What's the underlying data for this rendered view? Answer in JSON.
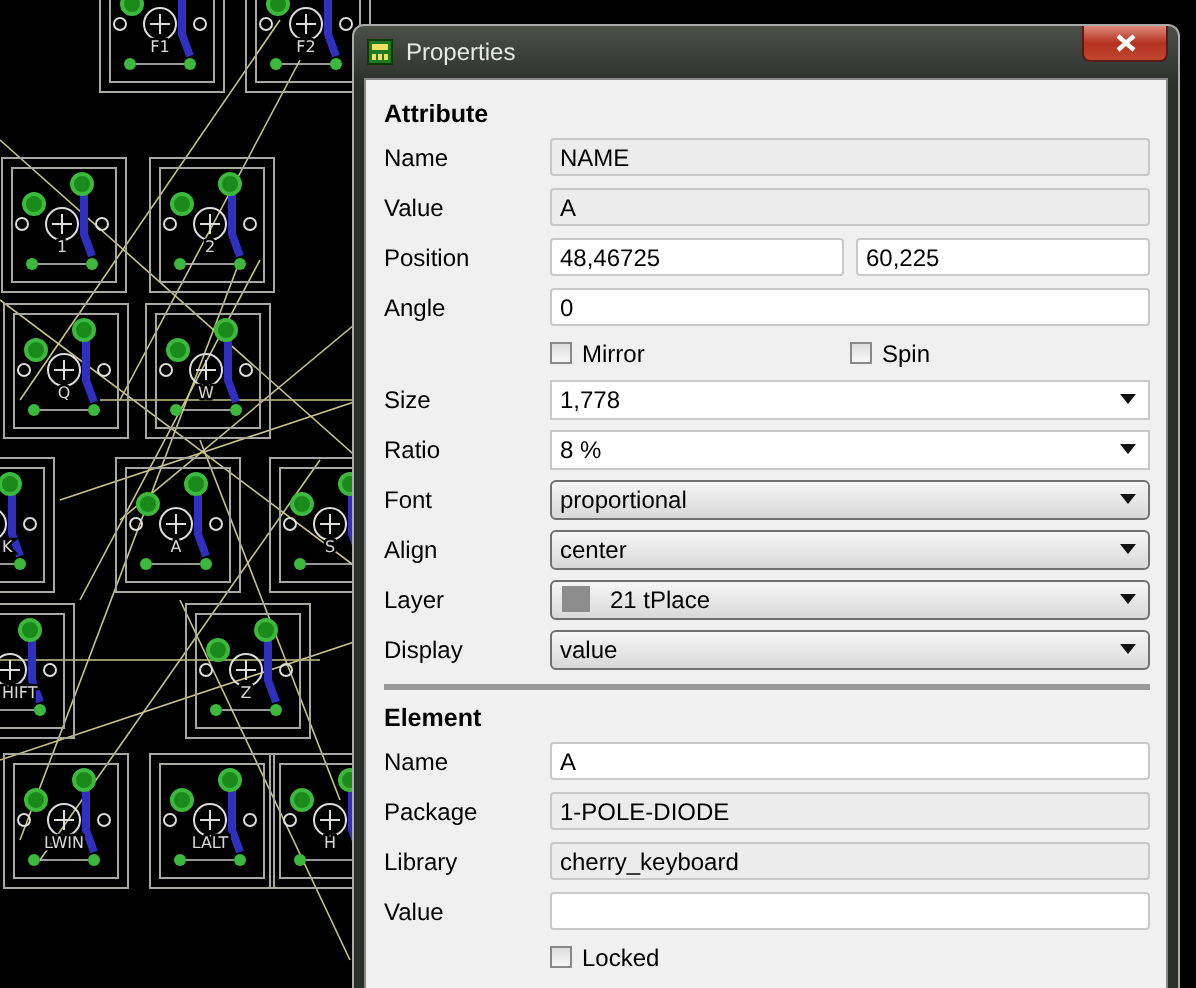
{
  "window": {
    "title": "Properties"
  },
  "board": {
    "labels": [
      "F1",
      "F2",
      "1",
      "2",
      "Q",
      "W",
      "K",
      "A",
      "S",
      "HIFT",
      "Z",
      "LWIN",
      "LALT",
      "H"
    ]
  },
  "sections": [
    {
      "title": "Attribute",
      "rows": [
        {
          "kind": "text",
          "label": "Name",
          "value": "NAME",
          "disabled": true
        },
        {
          "kind": "text",
          "label": "Value",
          "value": "A",
          "disabled": true
        },
        {
          "kind": "pair",
          "label": "Position",
          "values": [
            "48,46725",
            "60,225"
          ]
        },
        {
          "kind": "text",
          "label": "Angle",
          "value": "0",
          "disabled": false
        },
        {
          "kind": "checks",
          "items": [
            {
              "label": "Mirror",
              "checked": false
            },
            {
              "label": "Spin",
              "checked": false
            }
          ]
        },
        {
          "kind": "combo",
          "label": "Size",
          "value": "1,778",
          "editable": true
        },
        {
          "kind": "combo",
          "label": "Ratio",
          "value": "8 %",
          "editable": true
        },
        {
          "kind": "combo",
          "label": "Font",
          "value": "proportional",
          "editable": false
        },
        {
          "kind": "combo",
          "label": "Align",
          "value": "center",
          "editable": false
        },
        {
          "kind": "combo",
          "label": "Layer",
          "value": "21 tPlace",
          "editable": false,
          "color": "#8c8c8c"
        },
        {
          "kind": "combo",
          "label": "Display",
          "value": "value",
          "editable": false
        }
      ]
    },
    {
      "title": "Element",
      "rows": [
        {
          "kind": "text",
          "label": "Name",
          "value": "A",
          "disabled": false
        },
        {
          "kind": "text",
          "label": "Package",
          "value": "1-POLE-DIODE",
          "disabled": true
        },
        {
          "kind": "text",
          "label": "Library",
          "value": "cherry_keyboard",
          "disabled": true
        },
        {
          "kind": "text",
          "label": "Value",
          "value": "",
          "disabled": false
        },
        {
          "kind": "checks",
          "items": [
            {
              "label": "Locked",
              "checked": false
            }
          ]
        }
      ]
    }
  ]
}
